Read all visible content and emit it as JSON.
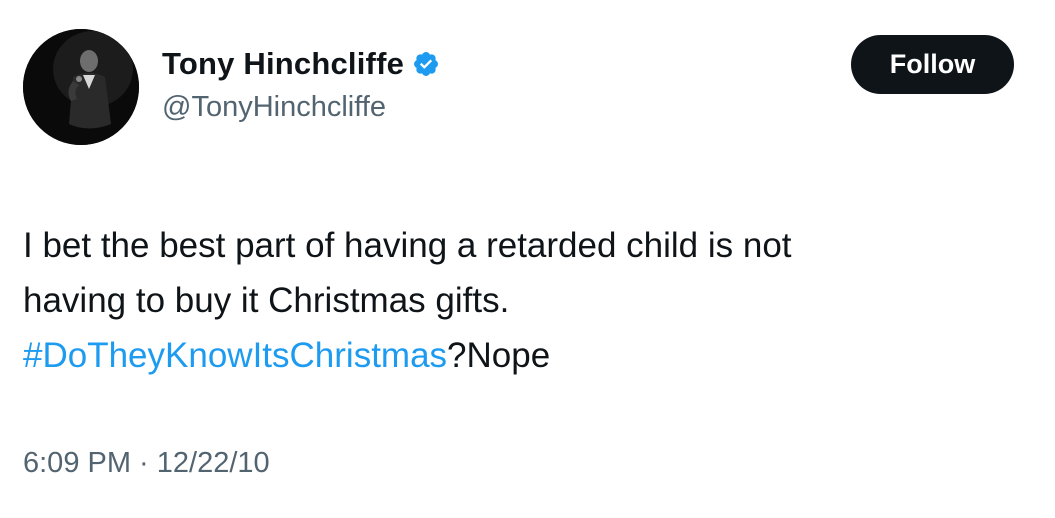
{
  "author": {
    "display_name": "Tony Hinchcliffe",
    "handle": "@TonyHinchcliffe",
    "verified_icon": "verified-badge-icon",
    "verified_color": "#1d9bf0"
  },
  "follow_button": {
    "label": "Follow"
  },
  "tweet": {
    "line1": "I bet the best part of having a retarded child is not",
    "line2": "having to buy it Christmas gifts.",
    "hashtag": "#DoTheyKnowItsChristmas",
    "after_hashtag": "?Nope"
  },
  "meta": {
    "time": "6:09 PM",
    "separator": " · ",
    "date": "12/22/10"
  },
  "colors": {
    "text": "#0f1419",
    "secondary": "#536471",
    "link": "#1d9bf0",
    "button_bg": "#0f1419"
  }
}
